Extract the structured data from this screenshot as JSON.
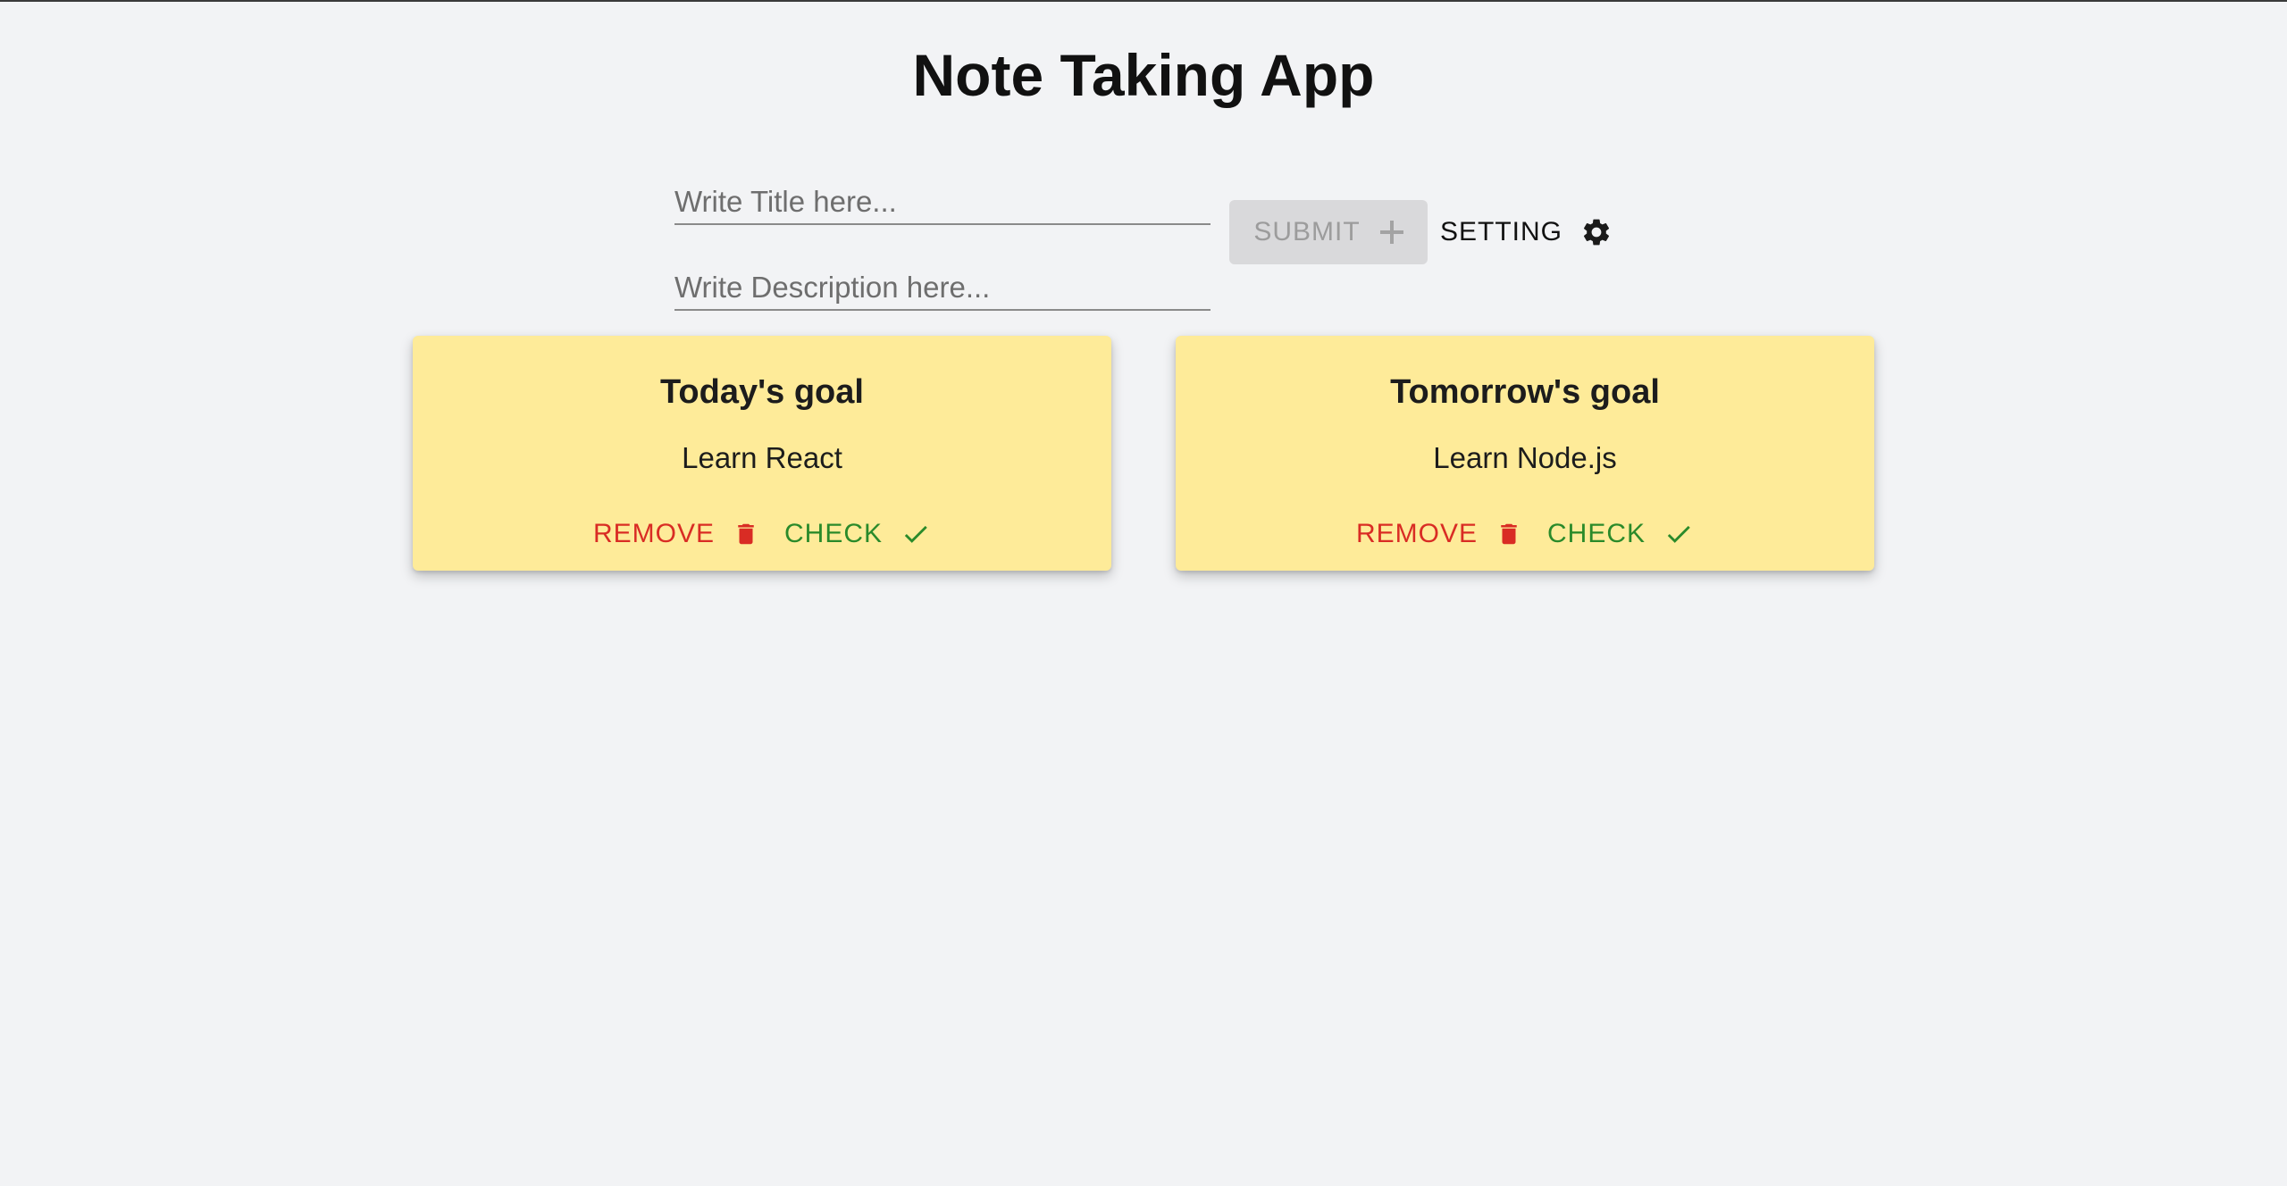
{
  "header": {
    "title": "Note Taking App"
  },
  "form": {
    "title_placeholder": "Write Title here...",
    "title_value": "",
    "description_placeholder": "Write Description here...",
    "description_value": "",
    "submit_label": "SUBMIT",
    "submit_icon": "plus-icon",
    "setting_label": "SETTING",
    "setting_icon": "gear-icon"
  },
  "notes": [
    {
      "title": "Today's goal",
      "description": "Learn React",
      "remove_label": "REMOVE",
      "remove_icon": "trash-icon",
      "check_label": "CHECK",
      "check_icon": "checkmark-icon"
    },
    {
      "title": "Tomorrow's goal",
      "description": "Learn Node.js",
      "remove_label": "REMOVE",
      "remove_icon": "trash-icon",
      "check_label": "CHECK",
      "check_icon": "checkmark-icon"
    }
  ],
  "colors": {
    "background": "#f2f3f5",
    "note_card": "#feeb99",
    "remove": "#d92c24",
    "check": "#2a8a2a",
    "submit_disabled_bg": "#d9d9db",
    "submit_disabled_text": "#9c9c9c"
  }
}
